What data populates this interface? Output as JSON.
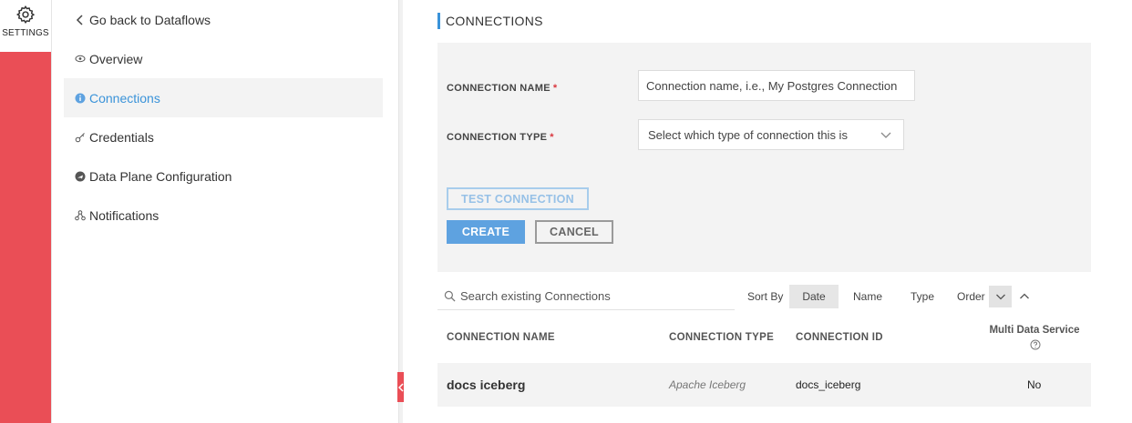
{
  "rail": {
    "settings_label": "SETTINGS",
    "icon": "gear-icon"
  },
  "nav": {
    "back": "Go back to Dataflows",
    "items": [
      {
        "label": "Overview",
        "icon": "eye-icon"
      },
      {
        "label": "Connections",
        "icon": "info-circle-icon",
        "active": true
      },
      {
        "label": "Credentials",
        "icon": "key-icon"
      },
      {
        "label": "Data Plane Configuration",
        "icon": "plane-icon"
      },
      {
        "label": "Notifications",
        "icon": "network-icon"
      }
    ]
  },
  "main": {
    "title": "CONNECTIONS",
    "form": {
      "name_label": "CONNECTION NAME",
      "name_value": "Connection name, i.e., My Postgres Connection",
      "type_label": "CONNECTION TYPE",
      "type_value": "Select which type of connection this is",
      "required_mark": "*",
      "test_button": "TEST CONNECTION",
      "create_button": "CREATE",
      "cancel_button": "CANCEL"
    },
    "search": {
      "placeholder": "Search existing Connections"
    },
    "sort": {
      "label": "Sort By",
      "options": [
        "Date",
        "Name",
        "Type"
      ],
      "active": "Date",
      "order_label": "Order"
    },
    "table": {
      "columns": [
        "CONNECTION NAME",
        "CONNECTION TYPE",
        "CONNECTION ID",
        "Multi Data Service"
      ],
      "rows": [
        {
          "name": "docs iceberg",
          "type": "Apache Iceberg",
          "id": "docs_iceberg",
          "multi": "No"
        }
      ]
    }
  },
  "colors": {
    "accent": "#3a93d9",
    "brand": "#ea4e56",
    "required": "#d9363e"
  }
}
